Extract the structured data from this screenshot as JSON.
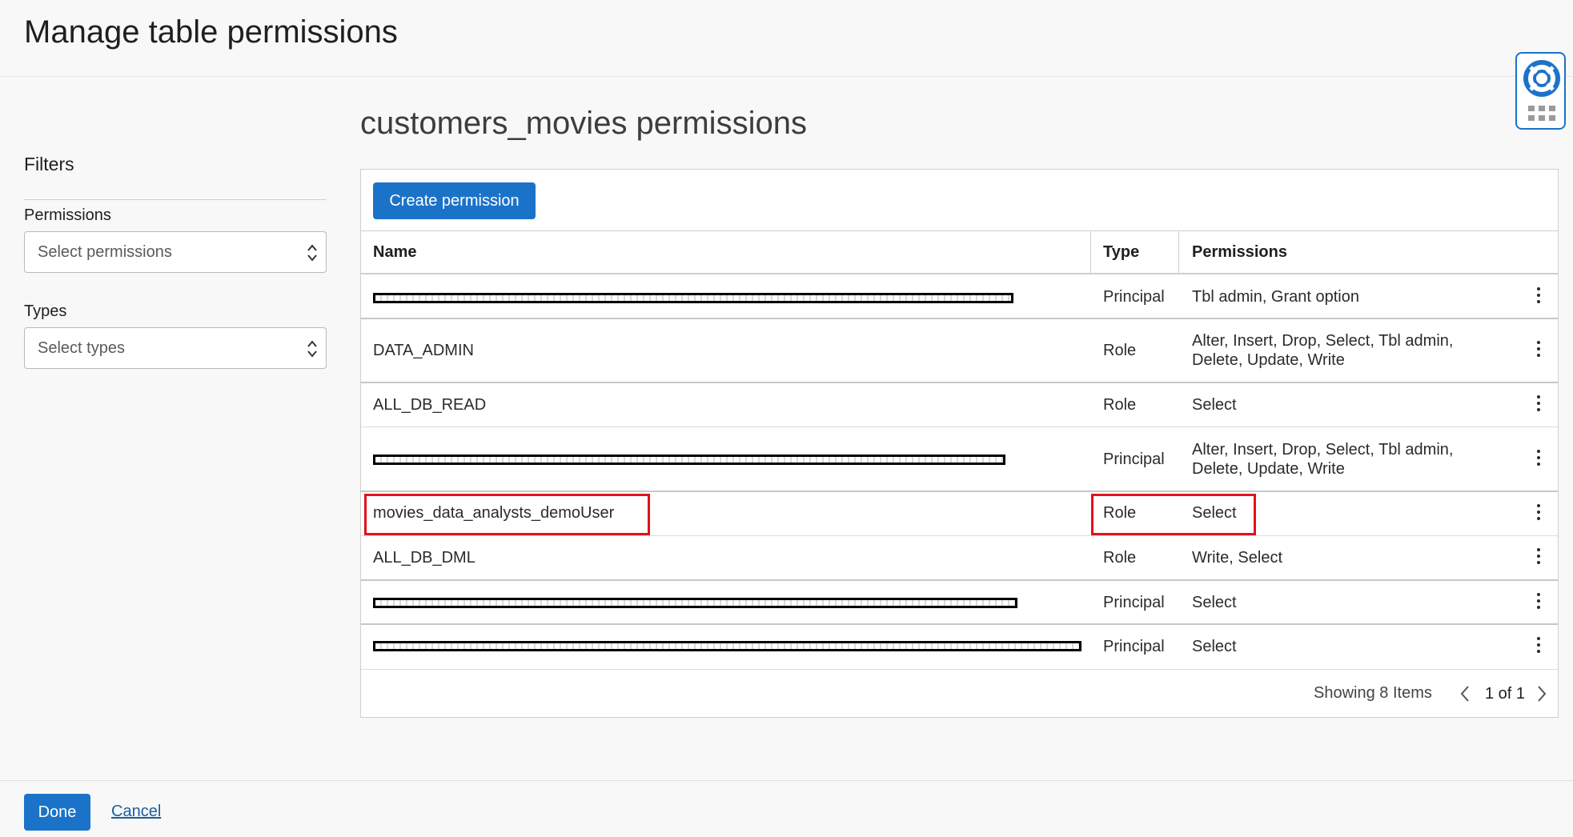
{
  "page": {
    "title": "Manage table permissions"
  },
  "help_widget": {
    "icon": "lifebuoy-icon",
    "secondary_icon": "grid-dots-icon",
    "accent": "#1b73c9"
  },
  "filters": {
    "title": "Filters",
    "permissions": {
      "label": "Permissions",
      "placeholder": "Select permissions"
    },
    "types": {
      "label": "Types",
      "placeholder": "Select types"
    }
  },
  "main": {
    "title": "customers_movies permissions",
    "create_button": "Create permission",
    "columns": {
      "name": "Name",
      "type": "Type",
      "permissions": "Permissions"
    },
    "rows": [
      {
        "name": "",
        "redacted": true,
        "type": "Principal",
        "permissions": "Tbl admin, Grant option"
      },
      {
        "name": "DATA_ADMIN",
        "redacted": false,
        "type": "Role",
        "permissions": "Alter, Insert, Drop, Select, Tbl admin, Delete, Update, Write"
      },
      {
        "name": "ALL_DB_READ",
        "redacted": false,
        "type": "Role",
        "permissions": "Select"
      },
      {
        "name": "",
        "redacted": true,
        "type": "Principal",
        "permissions": "Alter, Insert, Drop, Select, Tbl admin, Delete, Update, Write"
      },
      {
        "name": "movies_data_analysts_demoUser",
        "redacted": false,
        "highlighted": true,
        "type": "Role",
        "permissions": "Select"
      },
      {
        "name": "ALL_DB_DML",
        "redacted": false,
        "type": "Role",
        "permissions": "Write, Select"
      },
      {
        "name": "",
        "redacted": true,
        "type": "Principal",
        "permissions": "Select"
      },
      {
        "name": "",
        "redacted": true,
        "type": "Principal",
        "permissions": "Select"
      }
    ],
    "pagination": {
      "showing": "Showing 8 Items",
      "page": "1 of 1"
    }
  },
  "footer": {
    "done": "Done",
    "cancel": "Cancel"
  },
  "colors": {
    "primary": "#1b73c9",
    "highlight": "#e0121b",
    "link": "#1b5e9e"
  }
}
